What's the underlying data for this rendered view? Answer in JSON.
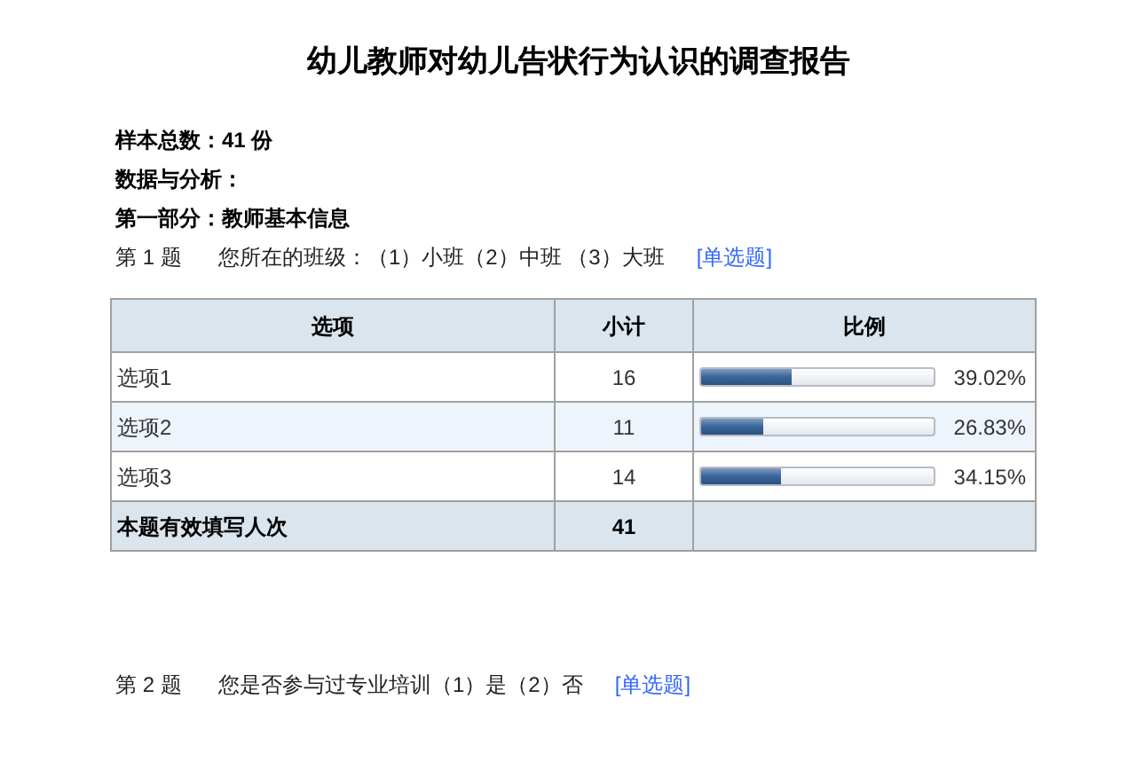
{
  "title": "幼儿教师对幼儿告状行为认识的调查报告",
  "info_lines": [
    "样本总数：41 份",
    "数据与分析：",
    "第一部分：教师基本信息"
  ],
  "questions": [
    {
      "number": "第 1 题",
      "text": "您所在的班级：（1）小班（2）中班 （3）大班",
      "type_link": "[单选题]",
      "table": {
        "columns": [
          "选项",
          "小计",
          "比例"
        ],
        "rows": [
          {
            "option": "选项1",
            "count": "16",
            "level": 0.3902,
            "percent": "39.02%"
          },
          {
            "option": "选项2",
            "count": "11",
            "level": 0.2683,
            "percent": "26.83%"
          },
          {
            "option": "选项3",
            "count": "14",
            "level": 0.3415,
            "percent": "34.15%"
          }
        ],
        "total": {
          "label": "本题有效填写人次",
          "count": "41"
        }
      }
    },
    {
      "number": "第 2 题",
      "text": "您是否参与过专业培训（1）是（2）否",
      "type_link": "[单选题]"
    }
  ]
}
